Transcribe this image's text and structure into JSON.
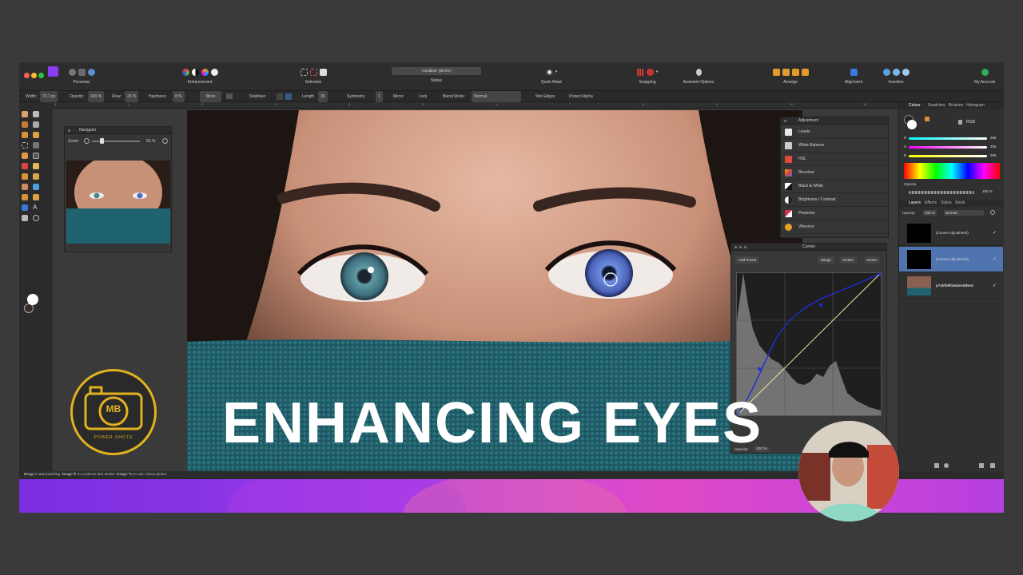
{
  "window": {
    "status_doc": "<Untitled> (50.0%)"
  },
  "toolbar": {
    "personas_label": "Personas",
    "enhancement_label": "Enhancement",
    "selection_label": "Selection",
    "status_label": "Status",
    "quickmask_label": "Quick Mask",
    "snapping_label": "Snapping",
    "assistant_label": "Assistant Options",
    "arrange_label": "Arrange",
    "alignment_label": "Alignment",
    "insertion_label": "Insertion",
    "account_label": "My Account"
  },
  "context": {
    "width_label": "Width:",
    "width_value": "73.7 px",
    "opacity_label": "Opacity:",
    "opacity_value": "100 %",
    "flow_label": "Flow:",
    "flow_value": "26 %",
    "hardness_label": "Hardness:",
    "hardness_value": "8 %",
    "more_label": "More",
    "stabiliser_label": "Stabiliser",
    "length_label": "Length",
    "length_value": "35",
    "symmetry_label": "Symmetry",
    "symmetry_value": "1",
    "mirror_label": "Mirror",
    "lock_label": "Lock",
    "blendmode_label": "Blend Mode:",
    "blendmode_value": "Normal",
    "wetedges_label": "Wet Edges",
    "protectalpha_label": "Protect Alpha"
  },
  "ruler": [
    "0",
    "1",
    "2",
    "3",
    "4",
    "5",
    "6",
    "7",
    "8",
    "9",
    "10",
    "11"
  ],
  "navigator": {
    "title": "Navigator",
    "zoom_label": "Zoom:",
    "zoom_value": "50 %"
  },
  "adjustment": {
    "title": "Adjustment",
    "items": [
      "Levels",
      "White Balance",
      "HSL",
      "Recolour",
      "Black & White",
      "Brightness / Contrast",
      "Posterise",
      "Vibrance"
    ],
    "icon_colors": [
      "#e8e8e8",
      "#cccccc",
      "#e14b3c",
      "#f0b000",
      "#ffffff",
      "#dddddd",
      "#d1344c",
      "#e8a020"
    ]
  },
  "curves": {
    "title": "Curves",
    "add_preset": "Add Preset",
    "merge": "Merge",
    "delete": "Delete",
    "reset": "Reset",
    "opacity_label": "Opacity:",
    "opacity_value": "100 %"
  },
  "colour_panel": {
    "tabs": [
      "Colour",
      "Swatches",
      "Brushes",
      "Histogram"
    ],
    "model": "RGB",
    "r_label": "R",
    "r_value": "255",
    "g_label": "G",
    "g_value": "255",
    "b_label": "B",
    "b_value": "255",
    "opacity_label": "Opacity",
    "opacity_value": "100 %"
  },
  "layers_panel": {
    "tabs": [
      "Layers",
      "Effects",
      "Styles",
      "Stock"
    ],
    "opacity_label": "Opacity:",
    "opacity_value": "100 %",
    "blend_value": "Normal",
    "layers": [
      {
        "name": "(Curves Adjustment)",
        "selected": false
      },
      {
        "name": "(Curves Adjustment)",
        "selected": true
      },
      {
        "name": "p7abfb9f18cbec6d5c6",
        "selected": false
      }
    ]
  },
  "statusbar": {
    "drag1": "Drag",
    "text1": " to start painting. ",
    "drag2": "Drag+⇧",
    "text2": " to continue last stroke. ",
    "drag3": "Drag+⌥",
    "text3": " to use colour picker."
  },
  "overlay": {
    "title": "ENHANCING EYES",
    "logo_initials": "MB",
    "logo_sub": "POWER SHOTS"
  },
  "colors": {
    "accent_yellow": "#e2b21e",
    "curve_blue": "#1c2fd8",
    "selected_layer": "#4f74b0"
  }
}
